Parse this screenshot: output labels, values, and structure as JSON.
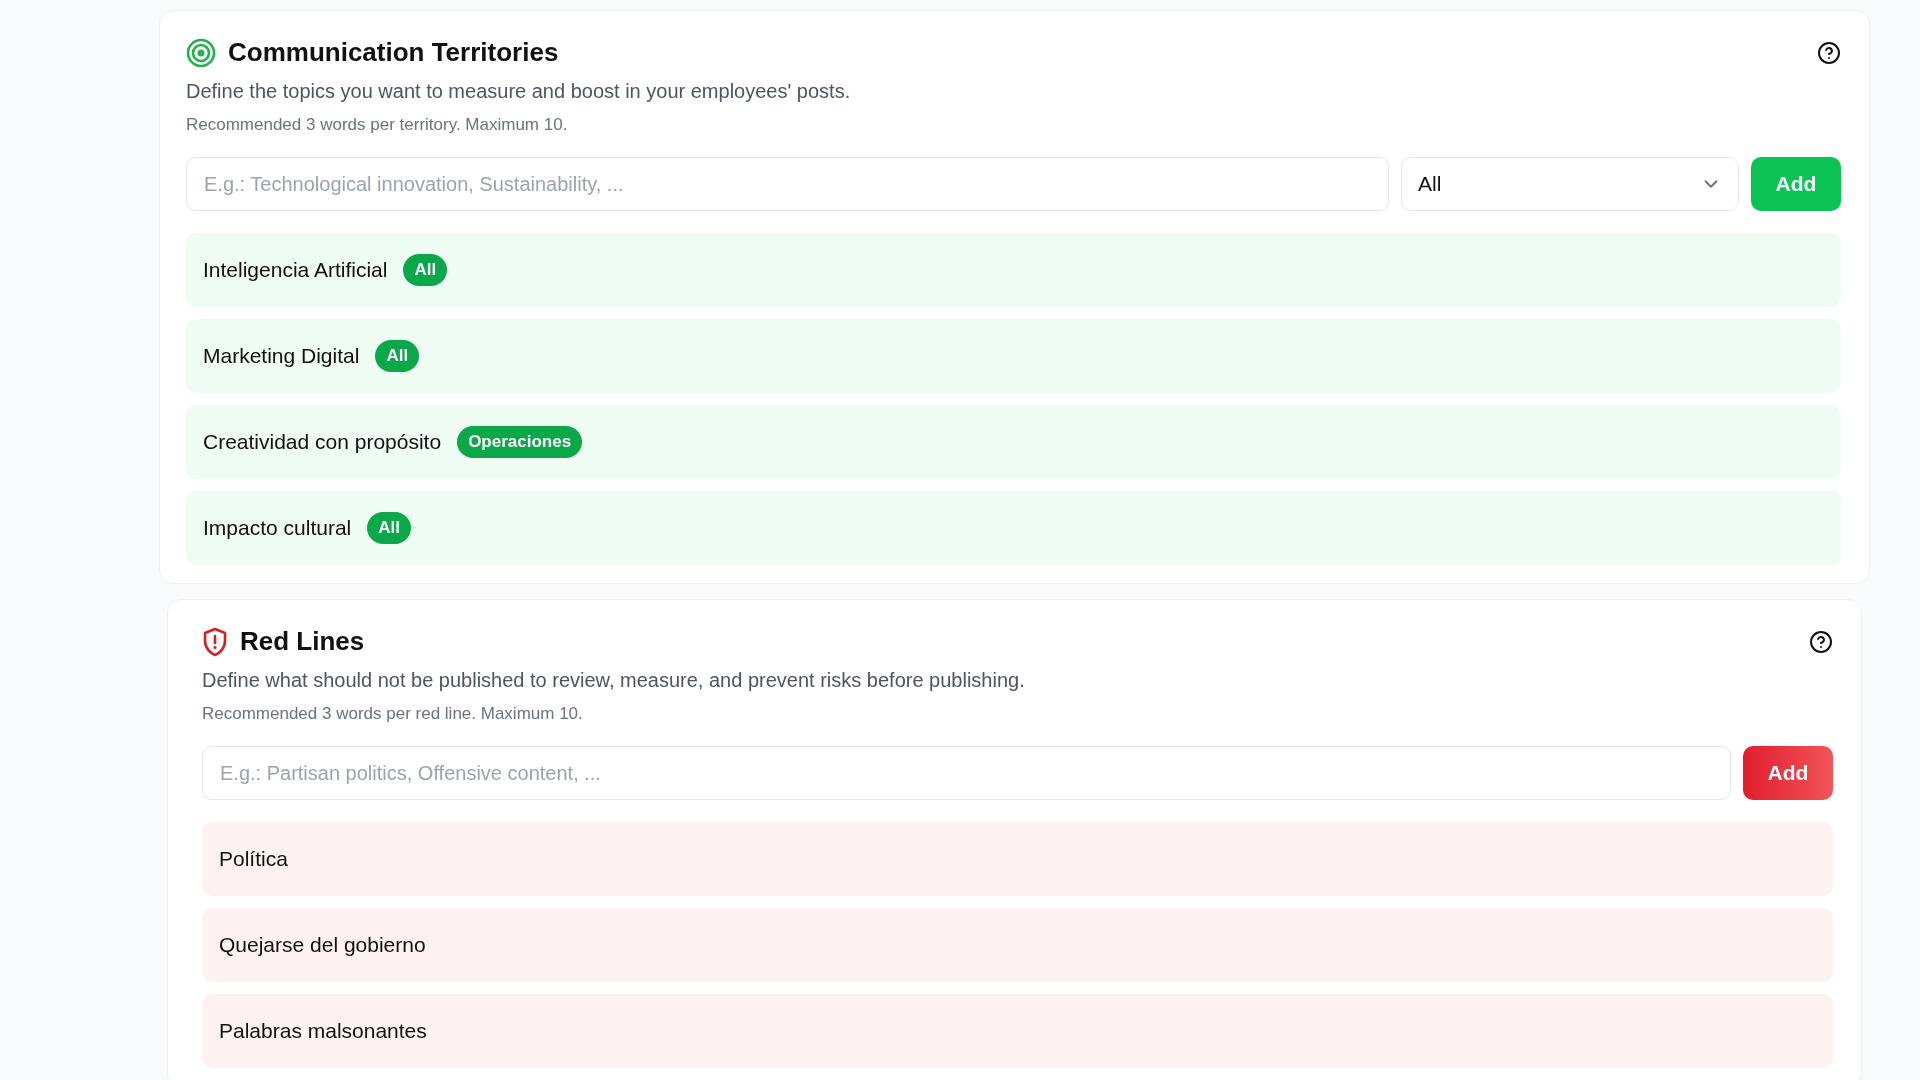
{
  "sections": [
    {
      "kind": "territories",
      "title": "Communication Territories",
      "description": "Define the topics you want to measure and boost in your employees' posts.",
      "hint": "Recommended 3 words per territory. Maximum 10.",
      "input": {
        "placeholder": "E.g.: Technological innovation, Sustainability, ..."
      },
      "select": {
        "value": "All"
      },
      "add_button": "Add",
      "items": [
        {
          "label": "Inteligencia Artificial",
          "tag": "All"
        },
        {
          "label": "Marketing Digital",
          "tag": "All"
        },
        {
          "label": "Creatividad con propósito",
          "tag": "Operaciones"
        },
        {
          "label": "Impacto cultural",
          "tag": "All"
        }
      ]
    },
    {
      "kind": "red_lines",
      "title": "Red Lines",
      "description": "Define what should not be published to review, measure, and prevent risks before publishing.",
      "hint": "Recommended 3 words per red line. Maximum 10.",
      "input": {
        "placeholder": "E.g.: Partisan politics, Offensive content, ..."
      },
      "add_button": "Add",
      "items": [
        {
          "label": "Política"
        },
        {
          "label": "Quejarse del gobierno"
        },
        {
          "label": "Palabras malsonantes"
        }
      ]
    }
  ]
}
